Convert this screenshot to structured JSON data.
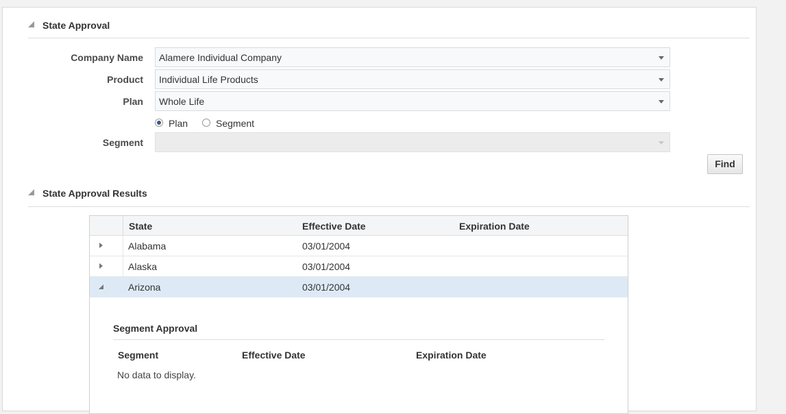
{
  "state_approval": {
    "title": "State Approval",
    "company_label": "Company Name",
    "company_value": "Alamere Individual Company",
    "product_label": "Product",
    "product_value": "Individual Life Products",
    "plan_label": "Plan",
    "plan_value": "Whole Life",
    "radio_plan_label": "Plan",
    "radio_segment_label": "Segment",
    "radio_selected": "Plan",
    "segment_label": "Segment",
    "segment_value": "",
    "find_label": "Find"
  },
  "results": {
    "title": "State Approval Results",
    "columns": [
      "State",
      "Effective Date",
      "Expiration Date"
    ],
    "rows": [
      {
        "state": "Alabama",
        "effective": "03/01/2004",
        "expiration": "",
        "expanded": false
      },
      {
        "state": "Alaska",
        "effective": "03/01/2004",
        "expiration": "",
        "expanded": false
      },
      {
        "state": "Arizona",
        "effective": "03/01/2004",
        "expiration": "",
        "expanded": true
      }
    ]
  },
  "segment_approval": {
    "title": "Segment Approval",
    "columns": [
      "Segment",
      "Effective Date",
      "Expiration Date"
    ],
    "empty_text": "No data to display."
  },
  "icons": {
    "section_collapse": "triangle-disclosure-icon",
    "row_expand": "chevron-right-icon",
    "row_collapse": "triangle-down-icon",
    "dropdown": "chevron-down-icon"
  },
  "colors": {
    "selected_row": "#ddeaf6",
    "radio_checked": "#3b5b7d"
  }
}
